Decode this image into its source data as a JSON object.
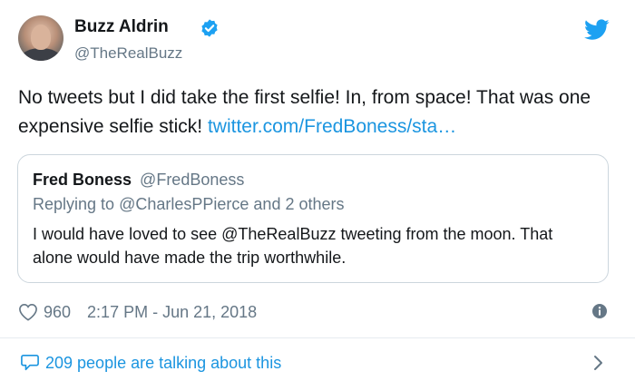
{
  "author": {
    "name": "Buzz Aldrin",
    "handle": "@TheRealBuzz",
    "verified": true
  },
  "tweet": {
    "text": "No tweets but I did take the first selfie! In, from space! That was one expensive selfie stick!",
    "link": "twitter.com/FredBoness/sta…"
  },
  "quoted": {
    "name": "Fred Boness",
    "handle": "@FredBoness",
    "reply_prefix": "Replying to",
    "reply_mention": "@CharlesPPierce",
    "reply_suffix": "and 2 others",
    "text": "I would have loved to see @TheRealBuzz tweeting from the moon. That alone would have made the trip worthwhile."
  },
  "meta": {
    "likes": "960",
    "timestamp": "2:17 PM - Jun 21, 2018"
  },
  "footer": {
    "talking": "209 people are talking about this"
  },
  "icons": {
    "verified": "verified-badge-icon",
    "brand": "twitter-bird-icon",
    "like": "heart-icon",
    "info": "info-icon",
    "comment": "speech-bubble-icon",
    "more": "chevron-right-icon"
  },
  "colors": {
    "brand_blue": "#1da1f2",
    "link_blue": "#1b95e0",
    "text": "#14171a",
    "muted": "#657786",
    "border": "#ccd6dd"
  }
}
